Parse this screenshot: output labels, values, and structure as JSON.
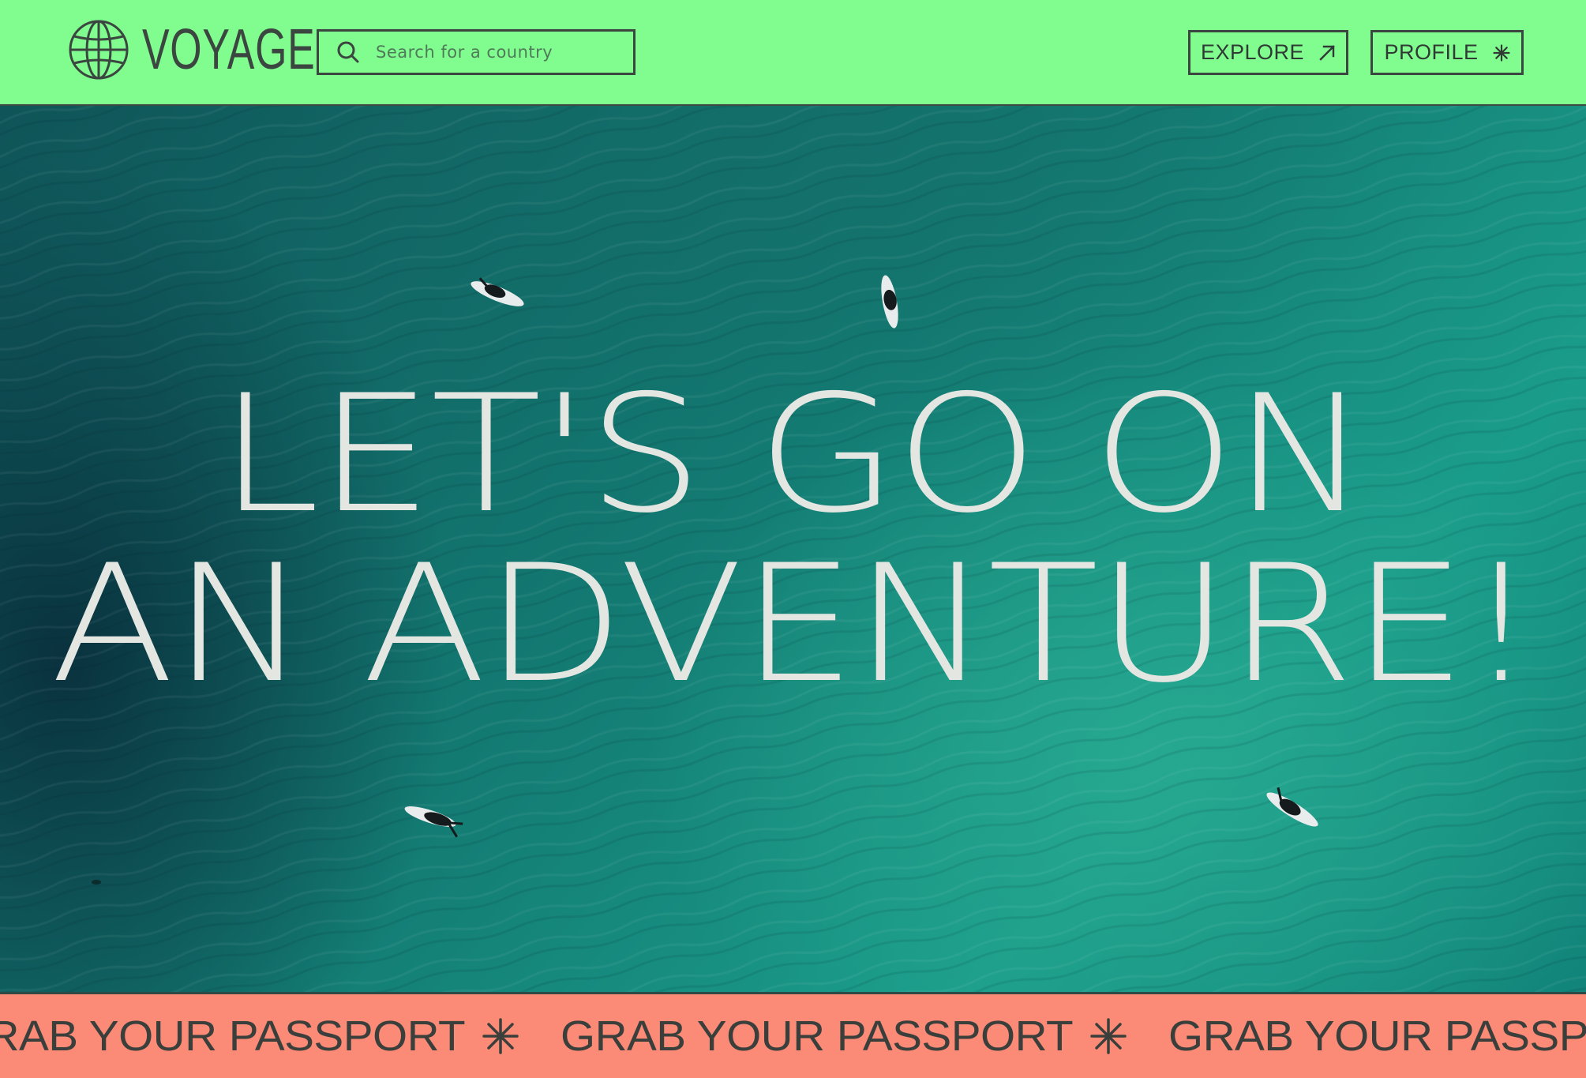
{
  "brand": {
    "name": "VOYAGE",
    "icon": "globe-icon"
  },
  "search": {
    "placeholder": "Search for a country",
    "icon": "search-icon"
  },
  "nav": {
    "explore_label": "EXPLORE",
    "explore_icon": "arrow-up-right-icon",
    "profile_label": "PROFILE",
    "profile_icon": "asterisk-icon"
  },
  "hero": {
    "line1": "LET'S GO ON",
    "line2": "AN ADVENTURE!",
    "background": "aerial-ocean-surfers-photo"
  },
  "marquee": {
    "items": [
      "GRAB YOUR PASSPORT",
      "GRAB YOUR PASSPORT",
      "GRAB YOUR PASSPORT"
    ],
    "separator_icon": "asterisk-icon"
  },
  "colors": {
    "nav_bg": "#80fd8e",
    "marquee_bg": "#fb8a76",
    "text_dark": "#3b4640",
    "headline": "#e4e6e2"
  }
}
